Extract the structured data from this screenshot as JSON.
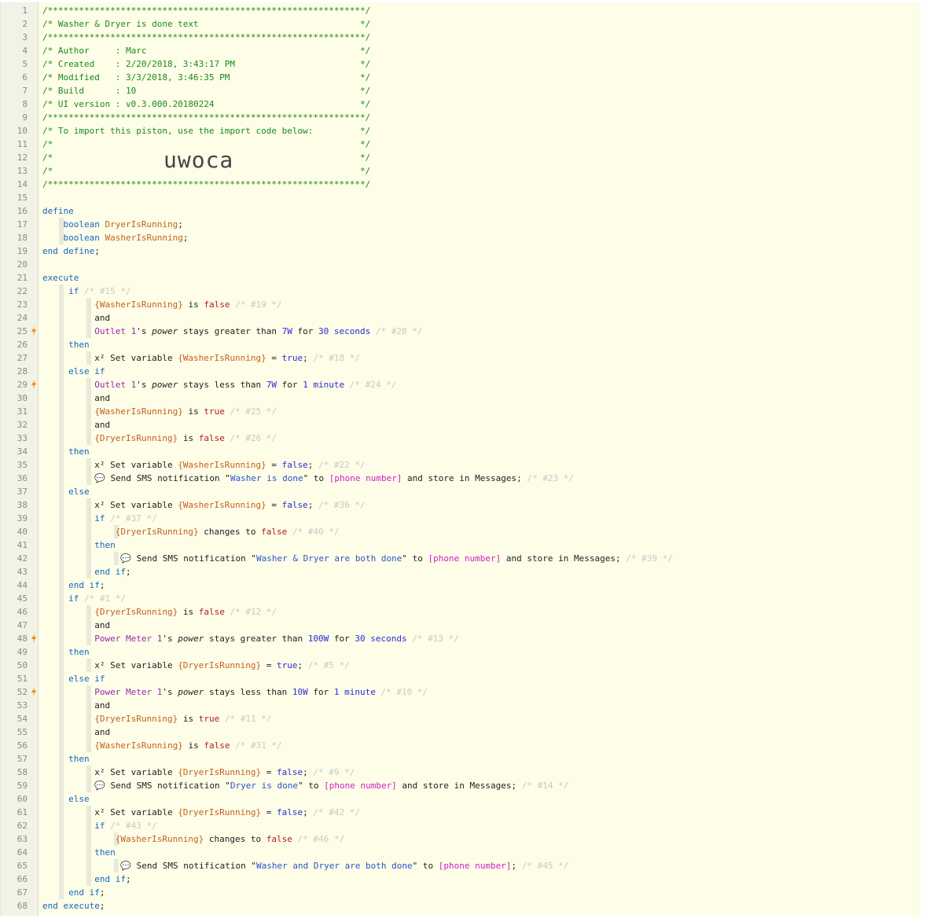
{
  "import_code": "uwoca",
  "trigger_lines": [
    25,
    29,
    48,
    52
  ],
  "colors": {
    "background": "#fdfde8",
    "gutter": "#f2f2e6",
    "trigger": "#f08c1e"
  },
  "lines": [
    [
      [
        "c-com",
        "/*************************************************************/"
      ]
    ],
    [
      [
        "c-com",
        "/* Washer & Dryer is done text                               */"
      ]
    ],
    [
      [
        "c-com",
        "/*************************************************************/"
      ]
    ],
    [
      [
        "c-com",
        "/* Author     : Marc                                         */"
      ]
    ],
    [
      [
        "c-com",
        "/* Created    : 2/20/2018, 3:43:17 PM                        */"
      ]
    ],
    [
      [
        "c-com",
        "/* Modified   : 3/3/2018, 3:46:35 PM                         */"
      ]
    ],
    [
      [
        "c-com",
        "/* Build      : 10                                           */"
      ]
    ],
    [
      [
        "c-com",
        "/* UI version : v0.3.000.20180224                            */"
      ]
    ],
    [
      [
        "c-com",
        "/*************************************************************/"
      ]
    ],
    [
      [
        "c-com",
        "/* To import this piston, use the import code below:         */"
      ]
    ],
    [
      [
        "c-com",
        "/*                                                           */"
      ]
    ],
    [
      [
        "c-com",
        "/*                                                           */"
      ]
    ],
    [
      [
        "c-com",
        "/*                                                           */"
      ]
    ],
    [
      [
        "c-com",
        "/*************************************************************/"
      ]
    ],
    [],
    [
      [
        "c-kw",
        "define"
      ]
    ],
    [
      [
        "",
        "    "
      ],
      [
        "c-kw",
        "boolean "
      ],
      [
        "c-var",
        "DryerIsRunning"
      ],
      [
        "",
        ";"
      ]
    ],
    [
      [
        "",
        "    "
      ],
      [
        "c-kw",
        "boolean "
      ],
      [
        "c-var",
        "WasherIsRunning"
      ],
      [
        "",
        ";"
      ]
    ],
    [
      [
        "c-kw",
        "end define"
      ],
      [
        "",
        ";"
      ]
    ],
    [],
    [
      [
        "c-kw",
        "execute"
      ]
    ],
    [
      [
        "",
        "     "
      ],
      [
        "c-kw",
        "if "
      ],
      [
        "c-note",
        "/* #15 */"
      ]
    ],
    [
      [
        "",
        "          "
      ],
      [
        "c-var",
        "{WasherIsRunning}"
      ],
      [
        "",
        " is "
      ],
      [
        "c-bool",
        "false "
      ],
      [
        "c-note",
        "/* #19 */"
      ]
    ],
    [
      [
        "",
        "          and"
      ]
    ],
    [
      [
        "",
        "          "
      ],
      [
        "c-dev",
        "Outlet 1"
      ],
      [
        "",
        "'s "
      ],
      [
        "c-it",
        "power"
      ],
      [
        "",
        " stays greater than "
      ],
      [
        "c-num",
        "7W"
      ],
      [
        "",
        " for "
      ],
      [
        "c-num",
        "30 seconds "
      ],
      [
        "c-note",
        "/* #20 */"
      ]
    ],
    [
      [
        "",
        "     "
      ],
      [
        "c-kw",
        "then"
      ]
    ],
    [
      [
        "",
        "          x² Set variable "
      ],
      [
        "c-var",
        "{WasherIsRunning}"
      ],
      [
        "",
        " = "
      ],
      [
        "c-lit",
        "true"
      ],
      [
        "",
        ";"
      ],
      [
        "c-note",
        " /* #18 */"
      ]
    ],
    [
      [
        "",
        "     "
      ],
      [
        "c-kw",
        "else if"
      ]
    ],
    [
      [
        "",
        "          "
      ],
      [
        "c-dev",
        "Outlet 1"
      ],
      [
        "",
        "'s "
      ],
      [
        "c-it",
        "power"
      ],
      [
        "",
        " stays less than "
      ],
      [
        "c-num",
        "7W"
      ],
      [
        "",
        " for "
      ],
      [
        "c-num",
        "1 minute "
      ],
      [
        "c-note",
        "/* #24 */"
      ]
    ],
    [
      [
        "",
        "          and"
      ]
    ],
    [
      [
        "",
        "          "
      ],
      [
        "c-var",
        "{WasherIsRunning}"
      ],
      [
        "",
        " is "
      ],
      [
        "c-bool",
        "true "
      ],
      [
        "c-note",
        "/* #25 */"
      ]
    ],
    [
      [
        "",
        "          and"
      ]
    ],
    [
      [
        "",
        "          "
      ],
      [
        "c-var",
        "{DryerIsRunning}"
      ],
      [
        "",
        " is "
      ],
      [
        "c-bool",
        "false "
      ],
      [
        "c-note",
        "/* #26 */"
      ]
    ],
    [
      [
        "",
        "     "
      ],
      [
        "c-kw",
        "then"
      ]
    ],
    [
      [
        "",
        "          x² Set variable "
      ],
      [
        "c-var",
        "{WasherIsRunning}"
      ],
      [
        "",
        " = "
      ],
      [
        "c-lit",
        "false"
      ],
      [
        "",
        ";"
      ],
      [
        "c-note",
        " /* #22 */"
      ]
    ],
    [
      [
        "",
        "          💬 Send SMS notification \""
      ],
      [
        "c-str",
        "Washer is done"
      ],
      [
        "",
        "\" to "
      ],
      [
        "c-ph",
        "[phone number]"
      ],
      [
        "",
        " and store in Messages;"
      ],
      [
        "c-note",
        " /* #23 */"
      ]
    ],
    [
      [
        "",
        "     "
      ],
      [
        "c-kw",
        "else"
      ]
    ],
    [
      [
        "",
        "          x² Set variable "
      ],
      [
        "c-var",
        "{WasherIsRunning}"
      ],
      [
        "",
        " = "
      ],
      [
        "c-lit",
        "false"
      ],
      [
        "",
        ";"
      ],
      [
        "c-note",
        " /* #36 */"
      ]
    ],
    [
      [
        "",
        "          "
      ],
      [
        "c-kw",
        "if "
      ],
      [
        "c-note",
        "/* #37 */"
      ]
    ],
    [
      [
        "",
        "              "
      ],
      [
        "c-var",
        "{DryerIsRunning}"
      ],
      [
        "",
        " changes to "
      ],
      [
        "c-bool",
        "false "
      ],
      [
        "c-note",
        "/* #40 */"
      ]
    ],
    [
      [
        "",
        "          "
      ],
      [
        "c-kw",
        "then"
      ]
    ],
    [
      [
        "",
        "               💬 Send SMS notification \""
      ],
      [
        "c-str",
        "Washer & Dryer are both done"
      ],
      [
        "",
        "\" to "
      ],
      [
        "c-ph",
        "[phone number]"
      ],
      [
        "",
        " and store in Messages;"
      ],
      [
        "c-note",
        " /* #39 */"
      ]
    ],
    [
      [
        "",
        "          "
      ],
      [
        "c-kw",
        "end if"
      ],
      [
        "",
        ";"
      ]
    ],
    [
      [
        "",
        "     "
      ],
      [
        "c-kw",
        "end if"
      ],
      [
        "",
        ";"
      ]
    ],
    [
      [
        "",
        "     "
      ],
      [
        "c-kw",
        "if "
      ],
      [
        "c-note",
        "/* #1 */"
      ]
    ],
    [
      [
        "",
        "          "
      ],
      [
        "c-var",
        "{DryerIsRunning}"
      ],
      [
        "",
        " is "
      ],
      [
        "c-bool",
        "false "
      ],
      [
        "c-note",
        "/* #12 */"
      ]
    ],
    [
      [
        "",
        "          and"
      ]
    ],
    [
      [
        "",
        "          "
      ],
      [
        "c-dev",
        "Power Meter 1"
      ],
      [
        "",
        "'s "
      ],
      [
        "c-it",
        "power"
      ],
      [
        "",
        " stays greater than "
      ],
      [
        "c-num",
        "100W"
      ],
      [
        "",
        " for "
      ],
      [
        "c-num",
        "30 seconds "
      ],
      [
        "c-note",
        "/* #13 */"
      ]
    ],
    [
      [
        "",
        "     "
      ],
      [
        "c-kw",
        "then"
      ]
    ],
    [
      [
        "",
        "          x² Set variable "
      ],
      [
        "c-var",
        "{DryerIsRunning}"
      ],
      [
        "",
        " = "
      ],
      [
        "c-lit",
        "true"
      ],
      [
        "",
        ";"
      ],
      [
        "c-note",
        " /* #5 */"
      ]
    ],
    [
      [
        "",
        "     "
      ],
      [
        "c-kw",
        "else if"
      ]
    ],
    [
      [
        "",
        "          "
      ],
      [
        "c-dev",
        "Power Meter 1"
      ],
      [
        "",
        "'s "
      ],
      [
        "c-it",
        "power"
      ],
      [
        "",
        " stays less than "
      ],
      [
        "c-num",
        "10W"
      ],
      [
        "",
        " for "
      ],
      [
        "c-num",
        "1 minute "
      ],
      [
        "c-note",
        "/* #10 */"
      ]
    ],
    [
      [
        "",
        "          and"
      ]
    ],
    [
      [
        "",
        "          "
      ],
      [
        "c-var",
        "{DryerIsRunning}"
      ],
      [
        "",
        " is "
      ],
      [
        "c-bool",
        "true "
      ],
      [
        "c-note",
        "/* #11 */"
      ]
    ],
    [
      [
        "",
        "          and"
      ]
    ],
    [
      [
        "",
        "          "
      ],
      [
        "c-var",
        "{WasherIsRunning}"
      ],
      [
        "",
        " is "
      ],
      [
        "c-bool",
        "false "
      ],
      [
        "c-note",
        "/* #31 */"
      ]
    ],
    [
      [
        "",
        "     "
      ],
      [
        "c-kw",
        "then"
      ]
    ],
    [
      [
        "",
        "          x² Set variable "
      ],
      [
        "c-var",
        "{DryerIsRunning}"
      ],
      [
        "",
        " = "
      ],
      [
        "c-lit",
        "false"
      ],
      [
        "",
        ";"
      ],
      [
        "c-note",
        " /* #9 */"
      ]
    ],
    [
      [
        "",
        "          💬 Send SMS notification \""
      ],
      [
        "c-str",
        "Dryer is done"
      ],
      [
        "",
        "\" to "
      ],
      [
        "c-ph",
        "[phone number]"
      ],
      [
        "",
        " and store in Messages;"
      ],
      [
        "c-note",
        " /* #14 */"
      ]
    ],
    [
      [
        "",
        "     "
      ],
      [
        "c-kw",
        "else"
      ]
    ],
    [
      [
        "",
        "          x² Set variable "
      ],
      [
        "c-var",
        "{DryerIsRunning}"
      ],
      [
        "",
        " = "
      ],
      [
        "c-lit",
        "false"
      ],
      [
        "",
        ";"
      ],
      [
        "c-note",
        " /* #42 */"
      ]
    ],
    [
      [
        "",
        "          "
      ],
      [
        "c-kw",
        "if "
      ],
      [
        "c-note",
        "/* #43 */"
      ]
    ],
    [
      [
        "",
        "              "
      ],
      [
        "c-var",
        "{WasherIsRunning}"
      ],
      [
        "",
        " changes to "
      ],
      [
        "c-bool",
        "false "
      ],
      [
        "c-note",
        "/* #46 */"
      ]
    ],
    [
      [
        "",
        "          "
      ],
      [
        "c-kw",
        "then"
      ]
    ],
    [
      [
        "",
        "               💬 Send SMS notification \""
      ],
      [
        "c-str",
        "Washer and Dryer are both done"
      ],
      [
        "",
        "\" to "
      ],
      [
        "c-ph",
        "[phone number]"
      ],
      [
        "",
        ";"
      ],
      [
        "c-note",
        " /* #45 */"
      ]
    ],
    [
      [
        "",
        "          "
      ],
      [
        "c-kw",
        "end if"
      ],
      [
        "",
        ";"
      ]
    ],
    [
      [
        "",
        "     "
      ],
      [
        "c-kw",
        "end if"
      ],
      [
        "",
        ";"
      ]
    ],
    [
      [
        "c-kw",
        "end execute"
      ],
      [
        "",
        ";"
      ]
    ]
  ]
}
